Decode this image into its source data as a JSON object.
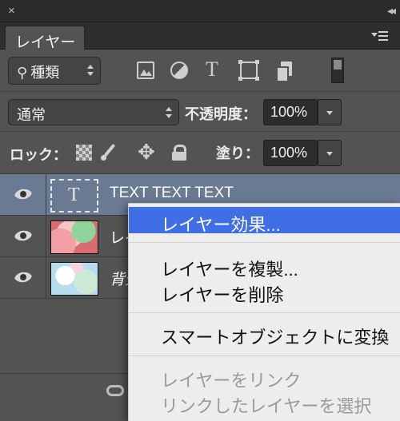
{
  "window": {
    "close_glyph": "×",
    "collapse_glyph": "◂◂"
  },
  "panel": {
    "tab_label": "レイヤー"
  },
  "filter": {
    "kind_label": "種類",
    "icons": [
      "image-filter-icon",
      "adjustment-filter-icon",
      "type-filter-icon",
      "shape-filter-icon",
      "smart-object-filter-icon"
    ],
    "type_glyph": "T"
  },
  "blending": {
    "mode": "通常",
    "opacity_label": "不透明度：",
    "opacity_value": "100%"
  },
  "locks": {
    "label": "ロック：",
    "move_glyph": "✥",
    "fill_label": "塗り：",
    "fill_value": "100%"
  },
  "layers": [
    {
      "name": "TEXT TEXT TEXT",
      "type": "text",
      "thumb_glyph": "T",
      "selected": true,
      "visible": true
    },
    {
      "name": "レイ",
      "type": "image",
      "selected": false,
      "visible": true
    },
    {
      "name": "背景",
      "type": "background",
      "selected": false,
      "visible": true
    }
  ],
  "context_menu": {
    "items": [
      {
        "label": "レイヤー効果...",
        "state": "highlighted"
      },
      {
        "label": "レイヤーを複製...",
        "state": "enabled"
      },
      {
        "label": "レイヤーを削除",
        "state": "enabled"
      },
      {
        "label": "スマートオブジェクトに変換",
        "state": "enabled"
      },
      {
        "label": "レイヤーをリンク",
        "state": "disabled"
      },
      {
        "label": "リンクしたレイヤーを選択",
        "state": "disabled"
      }
    ]
  }
}
